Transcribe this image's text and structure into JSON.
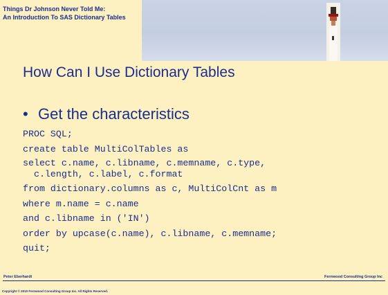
{
  "header": {
    "title_line1": "Things Dr Johnson Never Told Me:",
    "title_line2": "An Introduction To SAS Dictionary Tables"
  },
  "slide": {
    "title": "How Can I Use Dictionary Tables",
    "bullet": "Get the characteristics",
    "code_lines": [
      "PROC SQL;",
      "create table MultiColTables as",
      "select c.name, c.libname, c.memname, c.type,\n  c.length, c.label, c.format",
      "from dictionary.columns as c, MultiColCnt as m",
      "where m.name = c.name",
      "and c.libname in ('IN')",
      "order by upcase(c.name), c.libname, c.memname;",
      "quit;"
    ]
  },
  "footer": {
    "author": "Peter Eberhardt",
    "company": "Fernwood Consulting Group Inc",
    "copyright": "Copyright © 2010 Fernwood Consulting Group Inc. All Rights Reserved."
  },
  "colors": {
    "text": "#1a2d8c",
    "background": "#fdf1c2"
  }
}
